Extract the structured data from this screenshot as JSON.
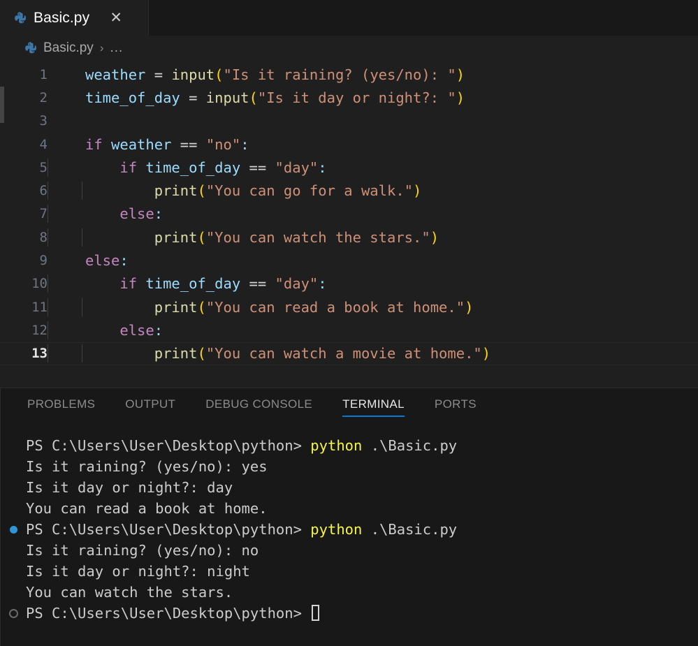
{
  "window": {
    "background": "#1f1f1f"
  },
  "colors": {
    "accent": "#0078d4",
    "tab_active_bg": "#1f1f1f",
    "tabbar_bg": "#181818",
    "editor_bg": "#1f1f1f",
    "panel_bg": "#181818",
    "terminal_text": "#cccccc",
    "terminal_command": "#f5f543",
    "decoration_success": "#2f95d4",
    "decoration_pending": "#6a6a6a",
    "syntax_variable": "#9cdcfe",
    "syntax_function": "#dcdcaa",
    "syntax_string": "#ce9178",
    "syntax_keyword": "#c586c0",
    "syntax_bracket": "#ffd700",
    "syntax_operator": "#d4d4d4",
    "linenumber": "#6e7681",
    "linenumber_active": "#e6e6e6"
  },
  "tabbar": {
    "tabs": [
      {
        "label": "Basic.py",
        "icon": "python-icon",
        "active": true,
        "close_glyph": "✕"
      }
    ]
  },
  "breadcrumb": {
    "icon": "python-icon",
    "crumb": "Basic.py",
    "separator": "›",
    "overflow": "..."
  },
  "editor": {
    "language": "python",
    "active_line": 13,
    "lines": [
      {
        "number": "1",
        "indent_guides": 0,
        "tokens": [
          {
            "text": "weather",
            "type": "variable"
          },
          {
            "text": " ",
            "type": "plain"
          },
          {
            "text": "=",
            "type": "operator"
          },
          {
            "text": " ",
            "type": "plain"
          },
          {
            "text": "input",
            "type": "function"
          },
          {
            "text": "(",
            "type": "bracket"
          },
          {
            "text": "\"Is it raining? (yes/no): \"",
            "type": "string"
          },
          {
            "text": ")",
            "type": "bracket"
          }
        ]
      },
      {
        "number": "2",
        "indent_guides": 0,
        "tokens": [
          {
            "text": "time_of_day",
            "type": "variable"
          },
          {
            "text": " ",
            "type": "plain"
          },
          {
            "text": "=",
            "type": "operator"
          },
          {
            "text": " ",
            "type": "plain"
          },
          {
            "text": "input",
            "type": "function"
          },
          {
            "text": "(",
            "type": "bracket"
          },
          {
            "text": "\"Is it day or night?: \"",
            "type": "string"
          },
          {
            "text": ")",
            "type": "bracket"
          }
        ]
      },
      {
        "number": "3",
        "indent_guides": 0,
        "tokens": []
      },
      {
        "number": "4",
        "indent_guides": 0,
        "tokens": [
          {
            "text": "if",
            "type": "keyword"
          },
          {
            "text": " ",
            "type": "plain"
          },
          {
            "text": "weather",
            "type": "variable"
          },
          {
            "text": " ",
            "type": "plain"
          },
          {
            "text": "==",
            "type": "operator"
          },
          {
            "text": " ",
            "type": "plain"
          },
          {
            "text": "\"no\"",
            "type": "string"
          },
          {
            "text": ":",
            "type": "punctuation"
          }
        ]
      },
      {
        "number": "5",
        "indent_guides": 1,
        "tokens": [
          {
            "text": "    ",
            "type": "plain"
          },
          {
            "text": "if",
            "type": "keyword"
          },
          {
            "text": " ",
            "type": "plain"
          },
          {
            "text": "time_of_day",
            "type": "variable"
          },
          {
            "text": " ",
            "type": "plain"
          },
          {
            "text": "==",
            "type": "operator"
          },
          {
            "text": " ",
            "type": "plain"
          },
          {
            "text": "\"day\"",
            "type": "string"
          },
          {
            "text": ":",
            "type": "punctuation"
          }
        ]
      },
      {
        "number": "6",
        "indent_guides": 2,
        "tokens": [
          {
            "text": "        ",
            "type": "plain"
          },
          {
            "text": "print",
            "type": "function"
          },
          {
            "text": "(",
            "type": "bracket"
          },
          {
            "text": "\"You can go for a walk.\"",
            "type": "string"
          },
          {
            "text": ")",
            "type": "bracket"
          }
        ]
      },
      {
        "number": "7",
        "indent_guides": 1,
        "tokens": [
          {
            "text": "    ",
            "type": "plain"
          },
          {
            "text": "else",
            "type": "keyword"
          },
          {
            "text": ":",
            "type": "punctuation"
          }
        ]
      },
      {
        "number": "8",
        "indent_guides": 2,
        "tokens": [
          {
            "text": "        ",
            "type": "plain"
          },
          {
            "text": "print",
            "type": "function"
          },
          {
            "text": "(",
            "type": "bracket"
          },
          {
            "text": "\"You can watch the stars.\"",
            "type": "string"
          },
          {
            "text": ")",
            "type": "bracket"
          }
        ]
      },
      {
        "number": "9",
        "indent_guides": 0,
        "tokens": [
          {
            "text": "else",
            "type": "keyword"
          },
          {
            "text": ":",
            "type": "punctuation"
          }
        ]
      },
      {
        "number": "10",
        "indent_guides": 1,
        "tokens": [
          {
            "text": "    ",
            "type": "plain"
          },
          {
            "text": "if",
            "type": "keyword"
          },
          {
            "text": " ",
            "type": "plain"
          },
          {
            "text": "time_of_day",
            "type": "variable"
          },
          {
            "text": " ",
            "type": "plain"
          },
          {
            "text": "==",
            "type": "operator"
          },
          {
            "text": " ",
            "type": "plain"
          },
          {
            "text": "\"day\"",
            "type": "string"
          },
          {
            "text": ":",
            "type": "punctuation"
          }
        ]
      },
      {
        "number": "11",
        "indent_guides": 2,
        "tokens": [
          {
            "text": "        ",
            "type": "plain"
          },
          {
            "text": "print",
            "type": "function"
          },
          {
            "text": "(",
            "type": "bracket"
          },
          {
            "text": "\"You can read a book at home.\"",
            "type": "string"
          },
          {
            "text": ")",
            "type": "bracket"
          }
        ]
      },
      {
        "number": "12",
        "indent_guides": 1,
        "tokens": [
          {
            "text": "    ",
            "type": "plain"
          },
          {
            "text": "else",
            "type": "keyword"
          },
          {
            "text": ":",
            "type": "punctuation"
          }
        ]
      },
      {
        "number": "13",
        "indent_guides": 2,
        "active": true,
        "tokens": [
          {
            "text": "        ",
            "type": "plain"
          },
          {
            "text": "print",
            "type": "function"
          },
          {
            "text": "(",
            "type": "bracket"
          },
          {
            "text": "\"You can watch a movie at home.\"",
            "type": "string"
          },
          {
            "text": ")",
            "type": "bracket"
          }
        ]
      }
    ]
  },
  "panel": {
    "tabs": [
      {
        "label": "PROBLEMS",
        "active": false
      },
      {
        "label": "OUTPUT",
        "active": false
      },
      {
        "label": "DEBUG CONSOLE",
        "active": false
      },
      {
        "label": "TERMINAL",
        "active": true
      },
      {
        "label": "PORTS",
        "active": false
      }
    ]
  },
  "terminal": {
    "lines": [
      {
        "decoration": "none",
        "segments": [
          {
            "text": "PS C:\\Users\\User\\Desktop\\python> ",
            "type": "prompt"
          },
          {
            "text": "python",
            "type": "command"
          },
          {
            "text": " .\\Basic.py",
            "type": "prompt"
          }
        ]
      },
      {
        "decoration": "none",
        "segments": [
          {
            "text": "Is it raining? (yes/no): yes",
            "type": "output"
          }
        ]
      },
      {
        "decoration": "none",
        "segments": [
          {
            "text": "Is it day or night?: day",
            "type": "output"
          }
        ]
      },
      {
        "decoration": "none",
        "segments": [
          {
            "text": "You can read a book at home.",
            "type": "output"
          }
        ]
      },
      {
        "decoration": "success",
        "segments": [
          {
            "text": "PS C:\\Users\\User\\Desktop\\python> ",
            "type": "prompt"
          },
          {
            "text": "python",
            "type": "command"
          },
          {
            "text": " .\\Basic.py",
            "type": "prompt"
          }
        ]
      },
      {
        "decoration": "none",
        "segments": [
          {
            "text": "Is it raining? (yes/no): no",
            "type": "output"
          }
        ]
      },
      {
        "decoration": "none",
        "segments": [
          {
            "text": "Is it day or night?: night",
            "type": "output"
          }
        ]
      },
      {
        "decoration": "none",
        "segments": [
          {
            "text": "You can watch the stars.",
            "type": "output"
          }
        ]
      },
      {
        "decoration": "pending",
        "cursor": true,
        "segments": [
          {
            "text": "PS C:\\Users\\User\\Desktop\\python> ",
            "type": "prompt"
          }
        ]
      }
    ]
  }
}
